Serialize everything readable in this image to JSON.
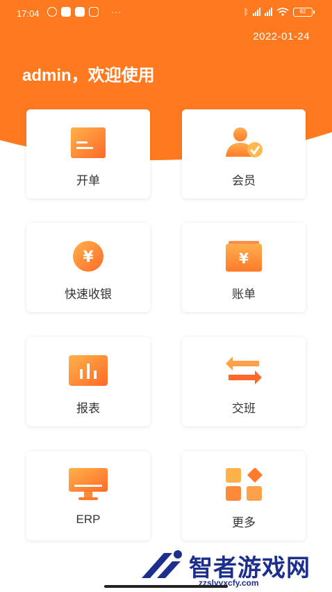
{
  "status_bar": {
    "time": "17:04",
    "more": "···",
    "battery": "82"
  },
  "header": {
    "date": "2022-01-24",
    "welcome": "admin，欢迎使用"
  },
  "menu": [
    {
      "label": "开单",
      "icon": "order-icon"
    },
    {
      "label": "会员",
      "icon": "member-icon"
    },
    {
      "label": "快速收银",
      "icon": "yen-coin-icon"
    },
    {
      "label": "账单",
      "icon": "bill-icon"
    },
    {
      "label": "报表",
      "icon": "report-chart-icon"
    },
    {
      "label": "交班",
      "icon": "shift-swap-icon"
    },
    {
      "label": "ERP",
      "icon": "monitor-icon"
    },
    {
      "label": "更多",
      "icon": "grid-more-icon"
    }
  ],
  "watermark": {
    "name": "智者游戏网",
    "url": "zzslyyxcfy.com"
  },
  "colors": {
    "accent": "#ff7a1f",
    "icon_gradient_start": "#ffb14a",
    "icon_gradient_end": "#ff6a28",
    "watermark": "#1c2f8c"
  }
}
